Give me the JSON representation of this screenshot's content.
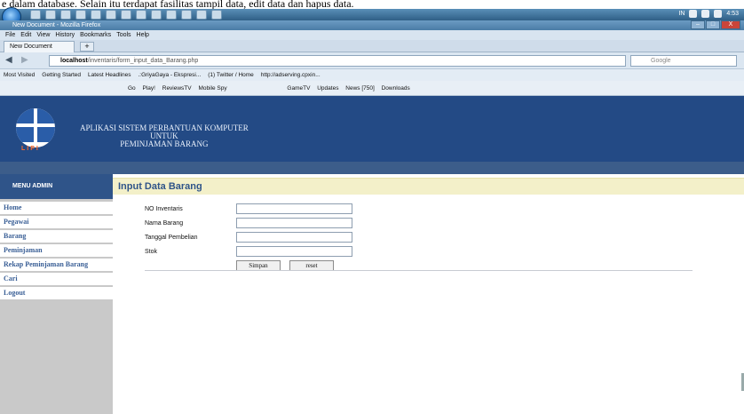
{
  "doc_caption": "e dalam database. Selain itu terdapat fasilitas tampil data, edit data dan hapus data.",
  "taskbar": {
    "clock": "4:53",
    "lang": "IN"
  },
  "window": {
    "title": "New Document - Mozilla Firefox",
    "controls": [
      "–",
      "□",
      "X"
    ]
  },
  "menu": [
    "File",
    "Edit",
    "View",
    "History",
    "Bookmarks",
    "Tools",
    "Help"
  ],
  "browser_tab": {
    "title": "New Document",
    "new_tab": "+"
  },
  "nav": {
    "back": "◀",
    "forward": "▶",
    "url_host": "localhost",
    "url_path": "/inventaris/form_input_data_Barang.php",
    "reload": "C",
    "search_placeholder": "Google"
  },
  "bookmarks": [
    "Most Visited",
    "Getting Started",
    "Latest Headlines",
    ".:GriyaGaya - Ekspresi...",
    "(1) Twitter / Home",
    "http://adserving.cpxin..."
  ],
  "toolbar2": [
    "Go",
    "Play!",
    "ReviewsTV",
    "Mobile Spy",
    "GameTV",
    "Updates",
    "News [750]",
    "Downloads"
  ],
  "header": {
    "logo_text": "LIPI",
    "title_line1": "APLIKASI SISTEM PERBANTUAN KOMPUTER",
    "title_line2": "UNTUK",
    "title_line3": "PEMINJAMAN BARANG"
  },
  "sidebar": {
    "heading": "MENU ADMIN",
    "items": [
      "Home",
      "Pegawai",
      "Barang",
      "Peminjaman",
      "Rekap Peminjaman Barang",
      "Cari",
      "Logout"
    ]
  },
  "main": {
    "heading": "Input Data Barang"
  },
  "form": {
    "fields": [
      {
        "label": "NO Inventaris",
        "value": ""
      },
      {
        "label": "Nama Barang",
        "value": ""
      },
      {
        "label": "Tanggal Pembelian",
        "value": ""
      },
      {
        "label": "Stok",
        "value": ""
      }
    ],
    "submit_label": "Simpan",
    "reset_label": "reset"
  }
}
